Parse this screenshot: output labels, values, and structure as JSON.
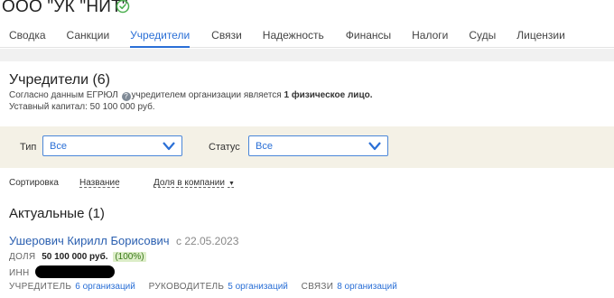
{
  "header": {
    "company_name": "ООО \"УК \"НИТ\"",
    "verified_icon": "check-circle-icon"
  },
  "tabs": [
    {
      "label": "Сводка",
      "active": false
    },
    {
      "label": "Санкции",
      "active": false
    },
    {
      "label": "Учредители",
      "active": true
    },
    {
      "label": "Связи",
      "active": false
    },
    {
      "label": "Надежность",
      "active": false
    },
    {
      "label": "Финансы",
      "active": false
    },
    {
      "label": "Налоги",
      "active": false
    },
    {
      "label": "Суды",
      "active": false
    },
    {
      "label": "Лицензии",
      "active": false
    }
  ],
  "colors": {
    "accent": "#2a6fd6",
    "filter_bg": "#f4f1e6",
    "share_badge_bg": "#dcedc8",
    "verified": "#4caf50"
  },
  "founders": {
    "title": "Учредители (6)",
    "desc_part1": "Согласно данным ЕГРЮЛ",
    "desc_part2": "учредителем организации является",
    "desc_bold": "1 физическое лицо.",
    "capital": "Уставный капитал: 50 100 000 руб."
  },
  "filters": {
    "type_label": "Тип",
    "type_value": "Все",
    "status_label": "Статус",
    "status_value": "Все"
  },
  "sort": {
    "label": "Сортировка",
    "option_name": "Название",
    "option_share": "Доля в компании"
  },
  "current": {
    "title": "Актуальные (1)"
  },
  "person": {
    "name": "Ушерович Кирилл Борисович",
    "date": "с 22.05.2023",
    "share_label": "Доля",
    "share_value": "50 100 000 руб.",
    "share_pct": "(100%)",
    "inn_label": "ИНН",
    "founder_label": "Учредитель",
    "founder_link": "6 организаций",
    "director_label": "Руководитель",
    "director_link": "5 организаций",
    "links_label": "Связи",
    "links_link": "8 организаций"
  }
}
